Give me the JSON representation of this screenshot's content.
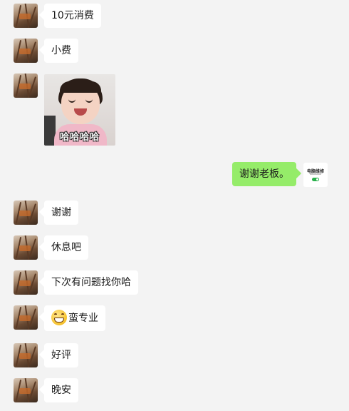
{
  "chat": {
    "messages": [
      {
        "side": "left",
        "type": "text",
        "text": "10元消费"
      },
      {
        "side": "left",
        "type": "text",
        "text": "小费"
      },
      {
        "side": "left",
        "type": "sticker",
        "caption": "哈哈哈哈"
      },
      {
        "side": "right",
        "type": "text",
        "text": "谢谢老板。"
      },
      {
        "side": "left",
        "type": "text",
        "text": "谢谢"
      },
      {
        "side": "left",
        "type": "text",
        "text": "休息吧"
      },
      {
        "side": "left",
        "type": "text",
        "text": "下次有问题找你哈"
      },
      {
        "side": "left",
        "type": "text",
        "emoji": "grin-emoji",
        "text": "蛮专业"
      },
      {
        "side": "left",
        "type": "text",
        "text": "好评"
      },
      {
        "side": "left",
        "type": "text",
        "text": "晚安"
      }
    ],
    "self_avatar_text": "电脑维修",
    "colors": {
      "background": "#f3f3f3",
      "incoming_bubble": "#ffffff",
      "outgoing_bubble": "#95ec69"
    }
  }
}
